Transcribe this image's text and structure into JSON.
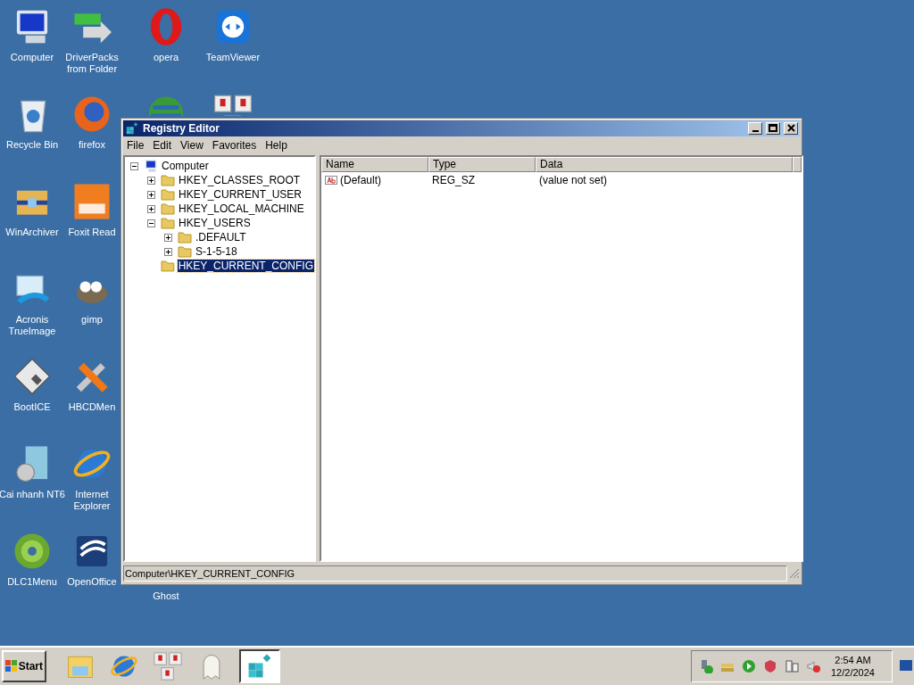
{
  "desktop_icons": [
    {
      "kind": "computer",
      "label": "Computer"
    },
    {
      "kind": "recycle",
      "label": "Recycle Bin"
    },
    {
      "kind": "archive",
      "label": "WinArchiver"
    },
    {
      "kind": "backup",
      "label": "Acronis TrueImage"
    },
    {
      "kind": "floppy",
      "label": "BootICE"
    },
    {
      "kind": "installer",
      "label": "Cai nhanh NT6"
    },
    {
      "kind": "wheel",
      "label": "DLC1Menu"
    },
    {
      "kind": "drivers",
      "label": "DriverPacks from Folder"
    },
    {
      "kind": "firefox",
      "label": "firefox"
    },
    {
      "kind": "pdf",
      "label": "Foxit Read"
    },
    {
      "kind": "gimp",
      "label": "gimp"
    },
    {
      "kind": "tools",
      "label": "HBCDMen"
    },
    {
      "kind": "ie",
      "label": "Internet Explorer"
    },
    {
      "kind": "office",
      "label": "OpenOffice"
    },
    {
      "kind": "opera",
      "label": "opera"
    },
    {
      "kind": "globe"
    },
    {
      "label": "Ghost"
    },
    {
      "kind": "teamviewer",
      "label": "TeamViewer"
    },
    {
      "kind": "keys"
    }
  ],
  "window": {
    "title": "Registry Editor",
    "menu": [
      "File",
      "Edit",
      "View",
      "Favorites",
      "Help"
    ],
    "tree": [
      {
        "label": "Computer",
        "kind": "computer",
        "expanded": true,
        "selected": false,
        "children": [
          {
            "label": "HKEY_CLASSES_ROOT",
            "kind": "folder",
            "expanded": false,
            "selected": false
          },
          {
            "label": "HKEY_CURRENT_USER",
            "kind": "folder",
            "expanded": false,
            "selected": false
          },
          {
            "label": "HKEY_LOCAL_MACHINE",
            "kind": "folder",
            "expanded": false,
            "selected": false
          },
          {
            "label": "HKEY_USERS",
            "kind": "folder",
            "expanded": true,
            "selected": false,
            "children": [
              {
                "label": ".DEFAULT",
                "kind": "folder",
                "expanded": false,
                "selected": false
              },
              {
                "label": "S-1-5-18",
                "kind": "folder",
                "expanded": false,
                "selected": false
              }
            ]
          },
          {
            "label": "HKEY_CURRENT_CONFIG",
            "kind": "folder",
            "selected": true
          }
        ]
      }
    ],
    "list": {
      "columns": [
        "Name",
        "Type",
        "Data"
      ],
      "rows": [
        {
          "name": "(Default)",
          "type": "REG_SZ",
          "data": "(value not set)"
        }
      ]
    },
    "status_bar": "Computer\\HKEY_CURRENT_CONFIG"
  },
  "taskbar": {
    "start": "Start",
    "quick_launch": [
      {
        "kind": "explorer",
        "active": false
      },
      {
        "kind": "ie",
        "active": false
      },
      {
        "kind": "keys",
        "active": false
      },
      {
        "kind": "ghost",
        "active": false
      },
      {
        "kind": "registry",
        "active": true
      }
    ],
    "clock": {
      "time": "2:54 AM",
      "date": "12/2/2024"
    }
  }
}
